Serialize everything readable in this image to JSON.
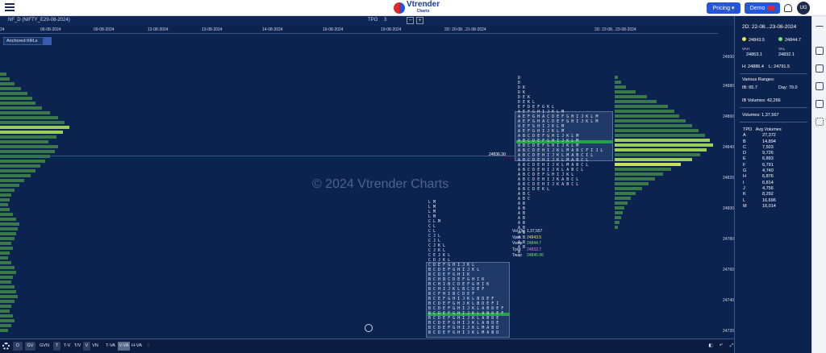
{
  "header": {
    "brand": "Vtrender",
    "brand_sub": "Charts",
    "pricing": "Pricing",
    "demo": "Demo",
    "avatar": "UG"
  },
  "chart": {
    "symbol": "NF_D (NIFTY_E29-08-2024)",
    "tpo_label": "TPO",
    "tpo_value": "3",
    "minus": "−",
    "plus": "+",
    "dates": [
      "24",
      "06-08-2024",
      "09-08-2024",
      "12-08-2024",
      "13-08-2024",
      "14-08-2024",
      "16-08-2024",
      "19-08-2024",
      "2D: 20-08...21-08-2024",
      "2D: 22-08...23-08-2024"
    ],
    "anchored": "Anchored KRLs",
    "prices": [
      "24900",
      "24880",
      "24860",
      "24840",
      "24820",
      "24800",
      "24780",
      "24760",
      "24740",
      "24720"
    ],
    "watermark": "© 2024 Vtrender Charts",
    "vpoc_line_value": "24836.30",
    "stats": [
      {
        "k": "Vol Qty",
        "v": "1,37,557",
        "color": "#ffffff"
      },
      {
        "k": "Vpoc",
        "v": "24843.5",
        "color": "#f0e05a"
      },
      {
        "k": "Vwap",
        "v": "24844.7",
        "color": "#6fe36a"
      },
      {
        "k": "Tpoc",
        "v": "24833.7",
        "color": "#e67cf0"
      },
      {
        "k": "Twap",
        "v": "24845.96",
        "color": "#6fe36a"
      }
    ]
  },
  "bottombar": {
    "items": [
      "D",
      "GV",
      "GVN",
      "T",
      "T-V",
      "T/V",
      "V",
      "VN",
      "T-VA",
      "V-VA",
      "H-VA"
    ]
  },
  "panel": {
    "title": "2D: 22-08...23-08-2024",
    "vpoc": "24843.5",
    "vwap": "24844.7",
    "vah_label": "VAH",
    "vah": "24863.1",
    "val_label": "VAL",
    "val": "24832.1",
    "hl": "H: 24886.4    L: 24791.5",
    "profiles": "Various Ranges:",
    "ib": "IB: 65.7",
    "day": "Day: 79.0",
    "ib_volumes": "IB Volumes: 42,266",
    "volumes": "Volumes: 1,37,567",
    "tpo_header": "TPO   Avg Volumes",
    "tpo_rows": [
      [
        "A",
        "27,372"
      ],
      [
        "B",
        "14,894"
      ],
      [
        "C",
        "7,503"
      ],
      [
        "D",
        "9,726"
      ],
      [
        "E",
        "6,893"
      ],
      [
        "F",
        "6,791"
      ],
      [
        "G",
        "4,740"
      ],
      [
        "H",
        "6,876"
      ],
      [
        "I",
        "6,814"
      ],
      [
        "J",
        "4,756"
      ],
      [
        "K",
        "8,292"
      ],
      [
        "L",
        "16,696"
      ],
      [
        "M",
        "16,014"
      ]
    ]
  }
}
